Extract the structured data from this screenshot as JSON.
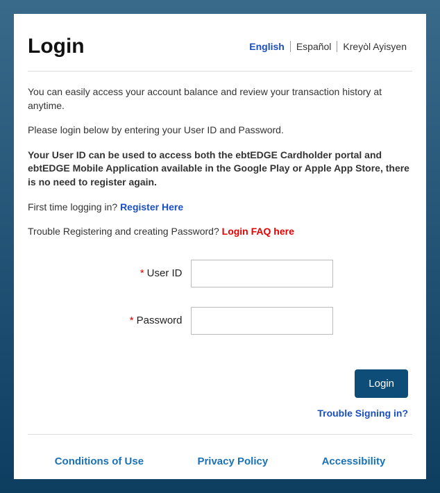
{
  "title": "Login",
  "languages": {
    "english": "English",
    "espanol": "Español",
    "kreyol": "Kreyòl Ayisyen"
  },
  "intro": {
    "p1": "You can easily access your account balance and review your transaction history at anytime.",
    "p2": "Please login below by entering your User ID and Password.",
    "p3": "Your User ID can be used to access both the ebtEDGE Cardholder portal and ebtEDGE Mobile Application available in the Google Play or Apple App Store, there is no need to register again.",
    "first_time_prefix": "First time logging in? ",
    "register_link": "Register Here",
    "trouble_reg_prefix": "Trouble Registering and creating Password? ",
    "faq_link": "Login FAQ here"
  },
  "form": {
    "user_id_label": "User ID",
    "password_label": "Password",
    "required_mark": "*",
    "user_id_value": "",
    "password_value": ""
  },
  "buttons": {
    "login": "Login"
  },
  "links": {
    "trouble_signin": "Trouble Signing in?"
  },
  "footer": {
    "conditions": "Conditions of Use",
    "privacy": "Privacy Policy",
    "accessibility": "Accessibility"
  }
}
